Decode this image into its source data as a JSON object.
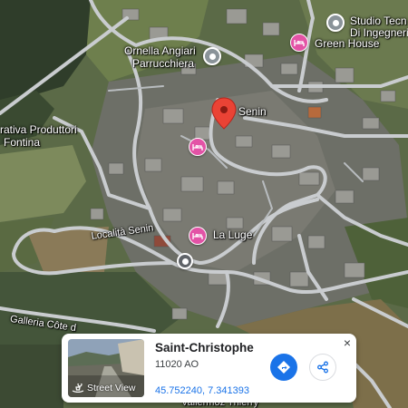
{
  "map": {
    "labels": {
      "studio": "Studio Tecn",
      "studio2": "Di Ingegneri",
      "green_house": "Green House",
      "ornella1": "Ornella Angiari",
      "ornella2": "Parrucchiera",
      "senin": "Senin",
      "cooperativa1": "rativa Produttori",
      "cooperativa2": "Fontina",
      "localita": "Località Senin",
      "la_luge": "La Luge",
      "galleria": "Galleria Côte d",
      "bottom_street": "Vallermoz Thierry"
    },
    "colors": {
      "poi_pin": "#e353a6",
      "marker": "#ea4335",
      "road": "#c9cccf"
    }
  },
  "card": {
    "place_name": "Saint-Christophe",
    "place_sub": "11020 AO",
    "coords": "45.752240, 7.341393",
    "street_view_label": "Street View",
    "close_symbol": "×",
    "icons": {
      "directions": "directions-icon",
      "share": "share-icon",
      "street_view": "street-view-icon"
    }
  }
}
